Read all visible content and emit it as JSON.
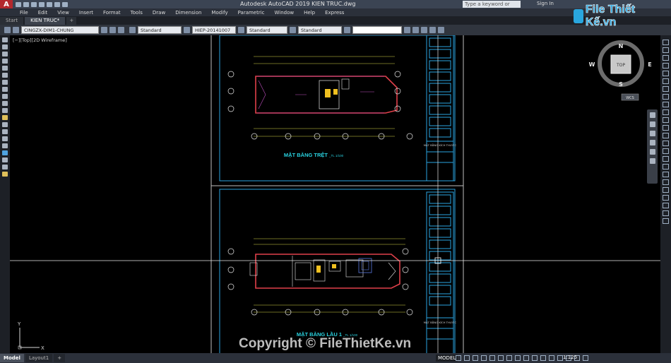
{
  "titlebar": {
    "app_logo": "A",
    "title": "Autodesk AutoCAD 2019   KIEN TRUC.dwg",
    "search_placeholder": "Type a keyword or phrase",
    "signin": "Sign In"
  },
  "brand": {
    "logo_text": "File Thiết Kế.vn"
  },
  "menu": [
    "File",
    "Edit",
    "View",
    "Insert",
    "Format",
    "Tools",
    "Draw",
    "Dimension",
    "Modify",
    "Parametric",
    "Window",
    "Help",
    "Express"
  ],
  "doc_tabs": {
    "start": "Start",
    "active": "KIEN TRUC*",
    "plus": "+"
  },
  "toolbar": {
    "layer": "CINGZX-DIM1-CHUNG",
    "text_style": "Standard",
    "dim_style": "HIEP-20141007",
    "table_style": "Standard",
    "multileader_style": "Standard"
  },
  "viewport": {
    "label": "[−][Top][2D Wireframe]"
  },
  "viewcube": {
    "north": "N",
    "south": "S",
    "east": "E",
    "west": "W",
    "top": "TOP",
    "wcs": "WCS"
  },
  "ucs": {
    "y": "Y",
    "x": "X"
  },
  "sheets": {
    "ground_floor_title": "MẶT BẰNG TRỆT",
    "ground_floor_scale": "_TL 1/100",
    "first_floor_title": "MẶT BẰNG LẦU 1",
    "first_floor_scale": "_TL 1/100",
    "titleblock_label": "MẶT BẰNG KÍCH THƯỚC"
  },
  "status": {
    "model_tab": "Model",
    "layout_tab": "Layout1",
    "plus": "+",
    "model_button": "MODEL",
    "scale": "1:125"
  },
  "watermark": "Copyright © FileThietKe.vn"
}
